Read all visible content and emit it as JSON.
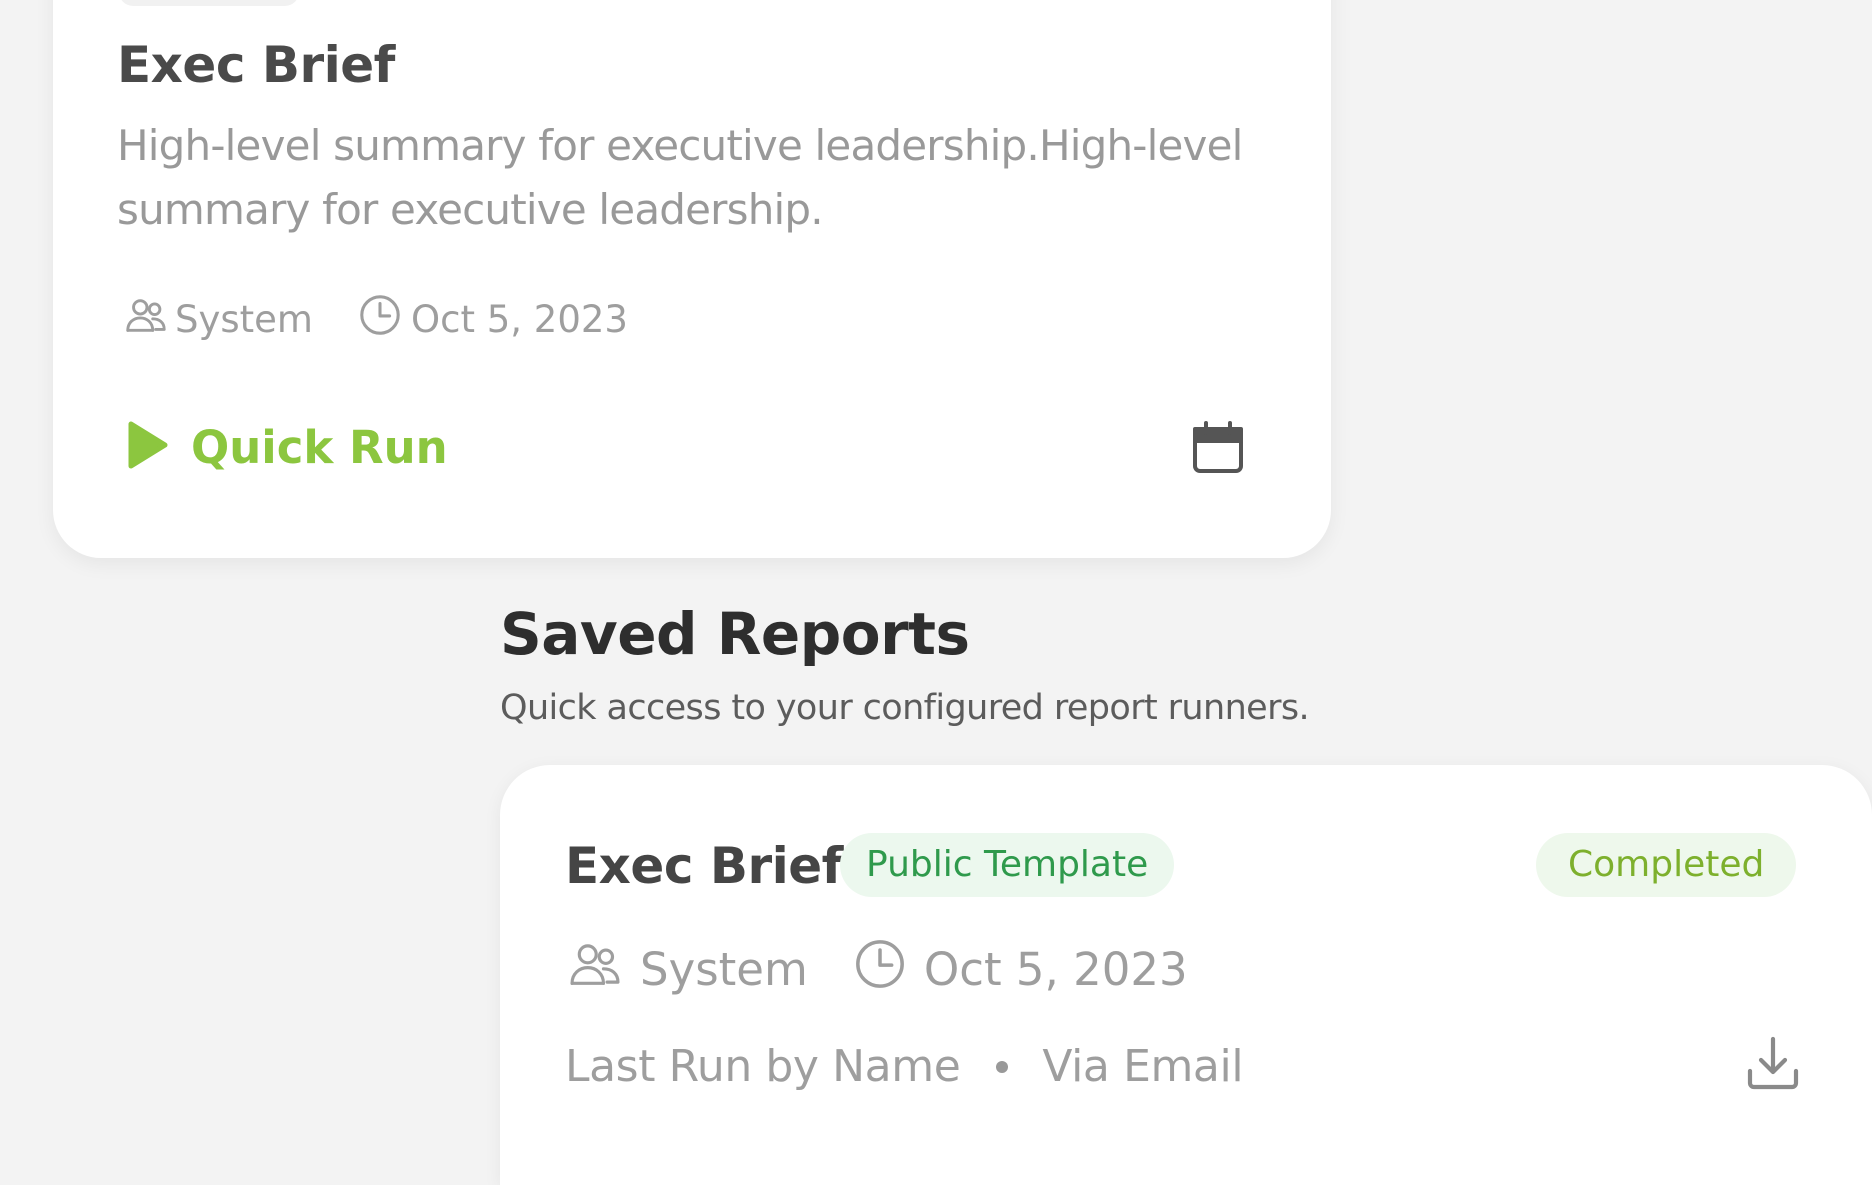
{
  "template_card": {
    "title": "Exec Brief",
    "description": "High-level summary for executive leadership.High-level summary for executive leadership.",
    "owner": "System",
    "date": "Oct 5, 2023",
    "quick_run_label": "Quick Run",
    "icons": {
      "owner": "users-icon",
      "date": "clock-icon",
      "quick_run": "play-icon",
      "schedule": "calendar-icon"
    }
  },
  "section": {
    "title": "Saved Reports",
    "subtitle": "Quick access to your configured report runners."
  },
  "report_card": {
    "title": "Exec Brief",
    "tag": "Public Template",
    "status": "Completed",
    "owner": "System",
    "date": "Oct 5, 2023",
    "last_run_by": "Last Run by Name",
    "delivery": "Via Email",
    "icons": {
      "owner": "users-icon",
      "date": "clock-icon",
      "download": "download-icon"
    }
  },
  "colors": {
    "background": "#f3f3f3",
    "card": "#ffffff",
    "accent_green": "#8cc63f",
    "tag_text": "#2f9a4c",
    "tag_bg": "#ecf8ee",
    "status_text": "#7db02d",
    "status_bg": "#eef8ec",
    "muted_text": "#9e9e9e"
  }
}
